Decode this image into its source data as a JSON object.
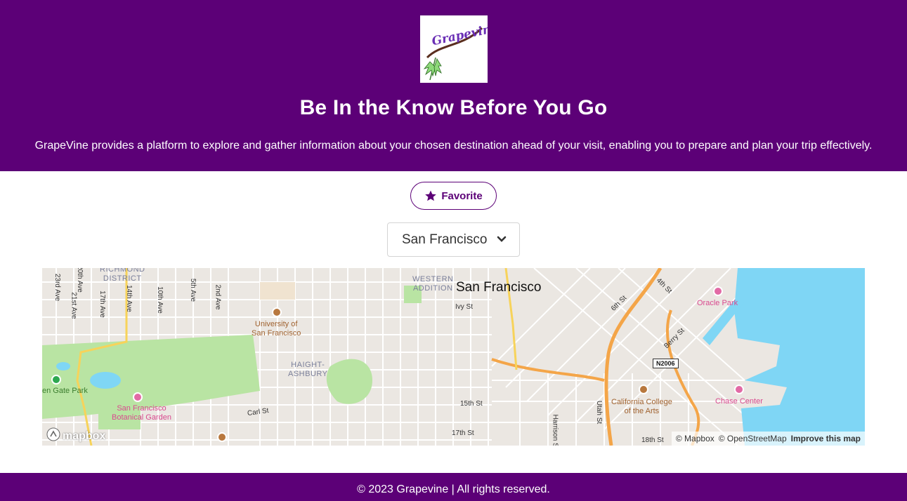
{
  "header": {
    "logo_text": "Grapevine",
    "title": "Be In the Know Before You Go",
    "subtitle": "GrapeVine provides a platform to explore and gather information about your chosen destination ahead of your visit, enabling you to prepare and plan your trip effectively."
  },
  "favorite_button": {
    "label": "Favorite",
    "icon": "star-icon"
  },
  "city_select": {
    "selected": "San Francisco",
    "icon": "chevron-down-icon"
  },
  "map": {
    "city_label": "San Francisco",
    "districts": [
      "RICHMOND\nDISTRICT",
      "WESTERN\nADDITION",
      "HAIGHT-\nASHBURY"
    ],
    "streets": [
      "23rd Ave",
      "21st Ave",
      "20th Ave",
      "17th Ave",
      "14th Ave",
      "10th Ave",
      "5th Ave",
      "2nd Ave",
      "Ivy St",
      "Carl St",
      "15th St",
      "17th St",
      "Harrison St",
      "Utah St",
      "18th St",
      "6th St",
      "4th St",
      "Berry St"
    ],
    "pois": {
      "university": "University of\nSan Francisco",
      "garden": "San Francisco\nBotanical Garden",
      "park": "en Gate Park",
      "oracle": "Oracle Park",
      "chase": "Chase Center",
      "college": "California College\nof the Arts"
    },
    "route_shield": "N2006",
    "logo": "mapbox",
    "attribution": [
      "© Mapbox",
      "© OpenStreetMap"
    ],
    "improve_link": "Improve this map"
  },
  "footer": {
    "text": "© 2023 Grapevine | All rights reserved."
  },
  "colors": {
    "brand": "#5c0077",
    "water": "#7fd6f5",
    "park": "#b9e4a3",
    "highway": "#f4a548"
  }
}
